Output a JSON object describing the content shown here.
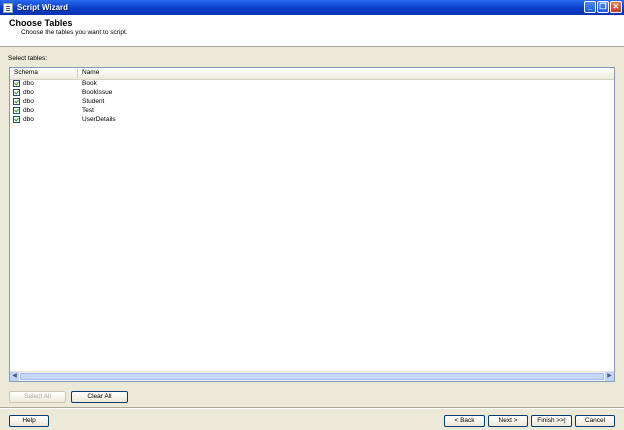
{
  "window": {
    "title": "Script Wizard"
  },
  "header": {
    "title": "Choose Tables",
    "subtitle": "Choose the tables you want to script."
  },
  "select_label": "Select tables:",
  "table": {
    "columns": [
      "Schema",
      "Name"
    ],
    "rows": [
      {
        "schema": "dbo",
        "name": "Book",
        "checked": true
      },
      {
        "schema": "dbo",
        "name": "BookIssue",
        "checked": true
      },
      {
        "schema": "dbo",
        "name": "Student",
        "checked": true
      },
      {
        "schema": "dbo",
        "name": "Test",
        "checked": true
      },
      {
        "schema": "dbo",
        "name": "UserDetails",
        "checked": true
      }
    ]
  },
  "buttons": {
    "select_all": "Select All",
    "clear_all": "Clear All",
    "help": "Help",
    "back": "< Back",
    "next": "Next >",
    "finish": "Finish >>|",
    "cancel": "Cancel"
  }
}
